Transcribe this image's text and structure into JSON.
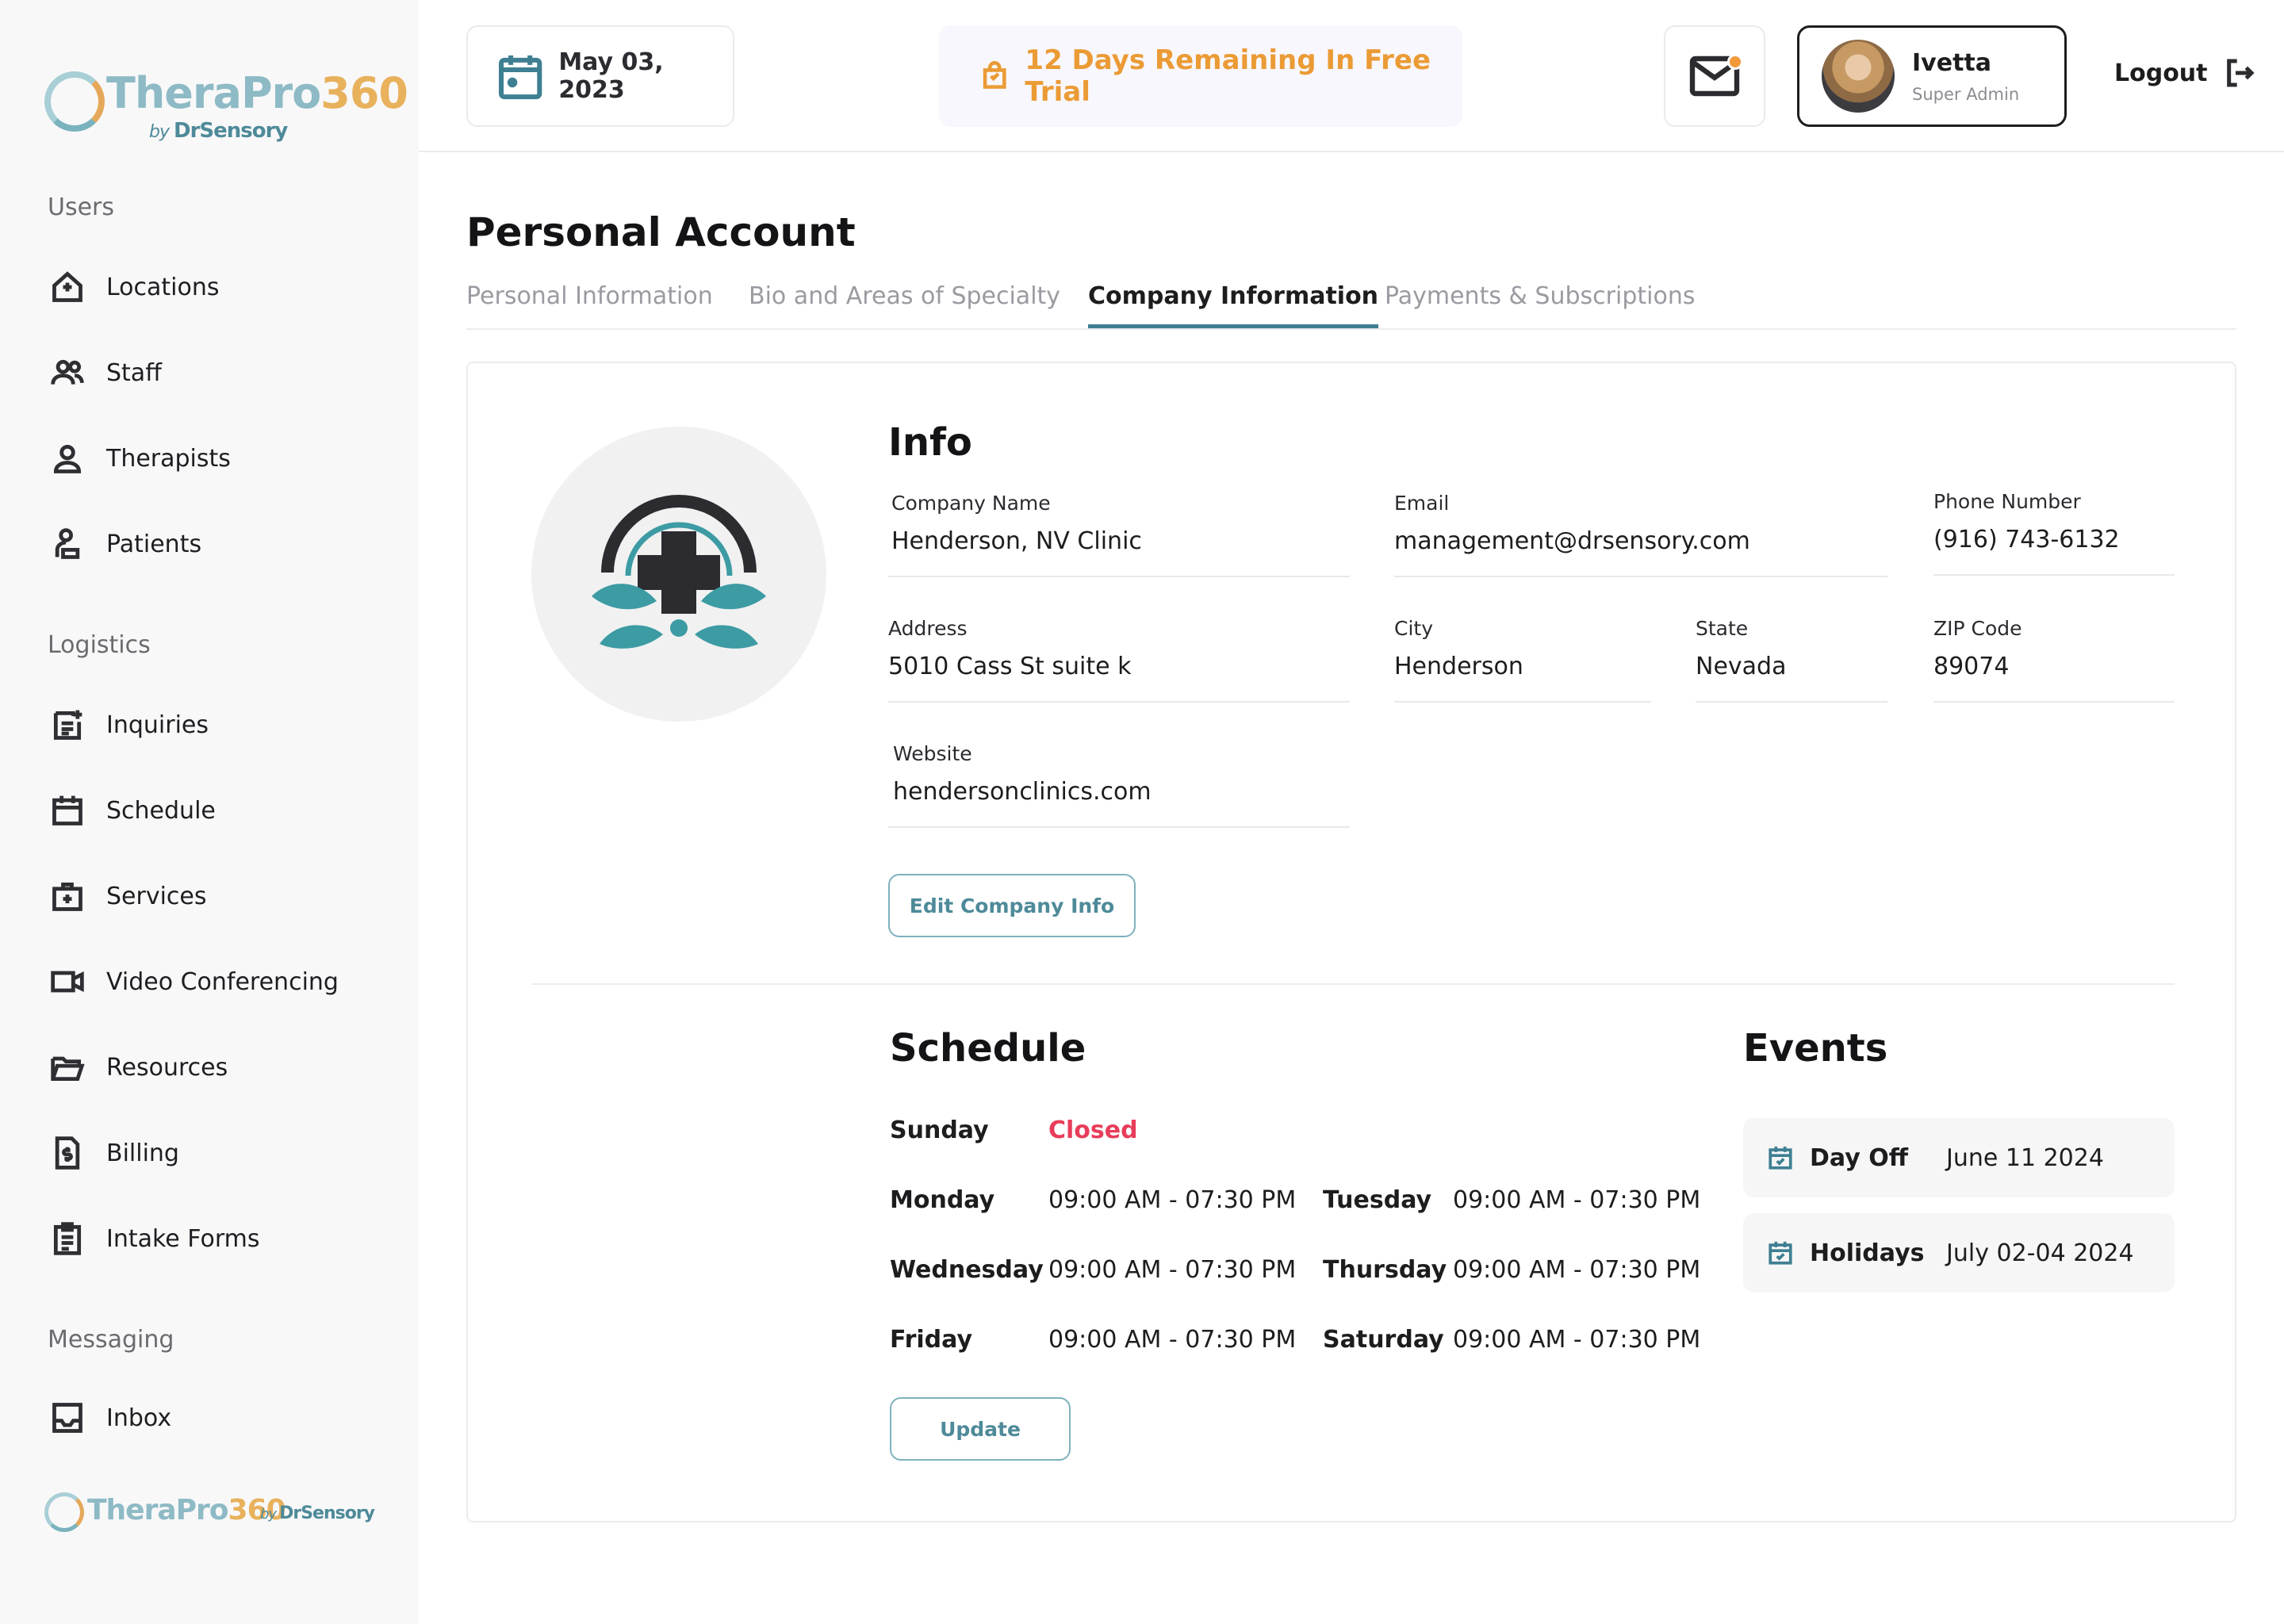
{
  "brand": {
    "name_part1": "TheraPro",
    "name_part2": "360",
    "by_prefix": "by",
    "by_name": "DrSensory"
  },
  "sidebar": {
    "sections": [
      {
        "label": "Users",
        "items": [
          {
            "label": "Locations",
            "icon": "location-house-icon"
          },
          {
            "label": "Staff",
            "icon": "people-icon"
          },
          {
            "label": "Therapists",
            "icon": "person-icon"
          },
          {
            "label": "Patients",
            "icon": "patient-icon"
          }
        ]
      },
      {
        "label": "Logistics",
        "items": [
          {
            "label": "Inquiries",
            "icon": "note-icon"
          },
          {
            "label": "Schedule",
            "icon": "calendar-icon"
          },
          {
            "label": "Services",
            "icon": "medkit-icon"
          },
          {
            "label": "Video Conferencing",
            "icon": "video-icon"
          },
          {
            "label": "Resources",
            "icon": "folder-icon"
          },
          {
            "label": "Billing",
            "icon": "invoice-icon"
          },
          {
            "label": "Intake Forms",
            "icon": "clipboard-icon"
          }
        ]
      },
      {
        "label": "Messaging",
        "items": [
          {
            "label": "Inbox",
            "icon": "inbox-icon"
          }
        ]
      }
    ]
  },
  "header": {
    "date": "May 03, 2023",
    "trial": "12 Days Remaining In Free Trial",
    "user_name": "Ivetta",
    "user_role": "Super Admin",
    "logout": "Logout",
    "colors": {
      "accent": "#3e7f92",
      "trial": "#eb9b35",
      "notification": "#f2993a"
    }
  },
  "page": {
    "title": "Personal Account",
    "tabs": [
      "Personal Information",
      "Bio and Areas of Specialty",
      "Company Information",
      "Payments & Subscriptions"
    ],
    "active_tab": "Company Information"
  },
  "info": {
    "heading": "Info",
    "company_name_label": "Company Name",
    "company_name": "Henderson, NV Clinic",
    "email_label": "Email",
    "email": "management@drsensory.com",
    "phone_label": "Phone Number",
    "phone": "(916) 743-6132",
    "address_label": "Address",
    "address": "5010 Cass St suite k",
    "city_label": "City",
    "city": "Henderson",
    "state_label": "State",
    "state": "Nevada",
    "zip_label": "ZIP Code",
    "zip": "89074",
    "website_label": "Website",
    "website": "hendersonclinics.com",
    "edit_button": "Edit Company Info"
  },
  "schedule": {
    "heading": "Schedule",
    "days": [
      {
        "day": "Sunday",
        "hours": "Closed",
        "closed": true
      },
      {
        "day": "Monday",
        "hours": "09:00 AM - 07:30 PM"
      },
      {
        "day": "Tuesday",
        "hours": "09:00 AM - 07:30 PM"
      },
      {
        "day": "Wednesday",
        "hours": "09:00 AM - 07:30 PM"
      },
      {
        "day": "Thursday",
        "hours": "09:00 AM - 07:30 PM"
      },
      {
        "day": "Friday",
        "hours": "09:00 AM - 07:30 PM"
      },
      {
        "day": "Saturday",
        "hours": "09:00 AM - 07:30 PM"
      }
    ],
    "update_button": "Update",
    "closed_color": "#e83d5a"
  },
  "events": {
    "heading": "Events",
    "items": [
      {
        "name": "Day Off",
        "date": "June 11 2024"
      },
      {
        "name": "Holidays",
        "date": "July 02-04 2024"
      }
    ]
  }
}
